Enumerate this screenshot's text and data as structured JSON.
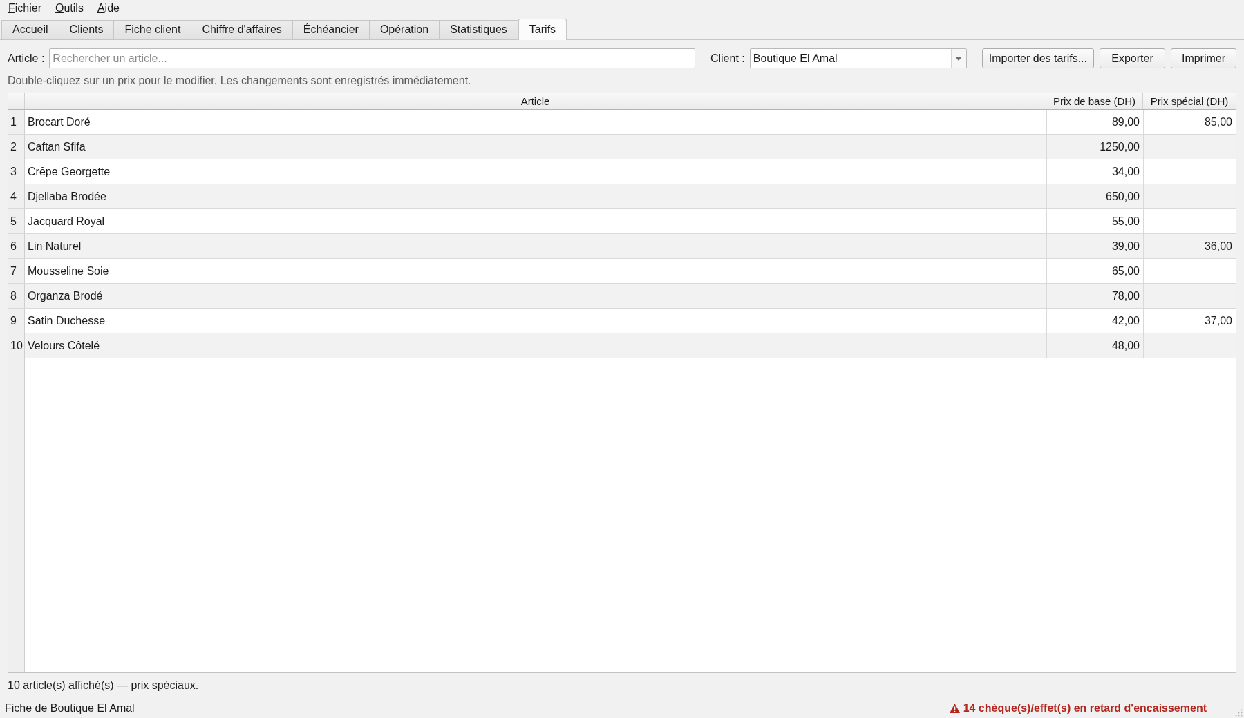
{
  "menu": [
    "Fichier",
    "Outils",
    "Aide"
  ],
  "tabs": [
    {
      "label": "Accueil",
      "selected": false
    },
    {
      "label": "Clients",
      "selected": false
    },
    {
      "label": "Fiche client",
      "selected": false
    },
    {
      "label": "Chiffre d'affaires",
      "selected": false
    },
    {
      "label": "Échéancier",
      "selected": false
    },
    {
      "label": "Opération",
      "selected": false
    },
    {
      "label": "Statistiques",
      "selected": false
    },
    {
      "label": "Tarifs",
      "selected": true
    }
  ],
  "filters": {
    "article_label": "Article :",
    "article_search": {
      "placeholder": "Rechercher un article..."
    },
    "client_label": "Client :",
    "client_combo": {
      "value": "Boutique El Amal"
    }
  },
  "buttons": [
    "Importer des tarifs...",
    "Exporter",
    "Imprimer"
  ],
  "hint": "Double-cliquez sur un prix pour le modifier. Les changements sont enregistrés immédiatement.",
  "table": {
    "columns": [
      "Article",
      "Prix de base (DH)",
      "Prix spécial (DH)"
    ],
    "rows": [
      {
        "number": "1",
        "article": "Brocart Doré",
        "base_price": "89,00",
        "special_price": "85,00"
      },
      {
        "number": "2",
        "article": "Caftan Sfifa",
        "base_price": "1250,00"
      },
      {
        "number": "3",
        "article": "Crêpe Georgette",
        "base_price": "34,00"
      },
      {
        "number": "4",
        "article": "Djellaba Brodée",
        "base_price": "650,00"
      },
      {
        "number": "5",
        "article": "Jacquard Royal",
        "base_price": "55,00"
      },
      {
        "number": "6",
        "article": "Lin Naturel",
        "base_price": "39,00",
        "special_price": "36,00"
      },
      {
        "number": "7",
        "article": "Mousseline Soie",
        "base_price": "65,00"
      },
      {
        "number": "8",
        "article": "Organza Brodé",
        "base_price": "78,00"
      },
      {
        "number": "9",
        "article": "Satin Duchesse",
        "base_price": "42,00",
        "special_price": "37,00"
      },
      {
        "number": "10",
        "article": "Velours Côtelé",
        "base_price": "48,00"
      }
    ]
  },
  "summary": "10 article(s) affiché(s) — prix spéciaux.",
  "status_bar": {
    "text": "Fiche de Boutique El Amal",
    "warning": "14 chèque(s)/effet(s) en retard d'encaissement"
  }
}
